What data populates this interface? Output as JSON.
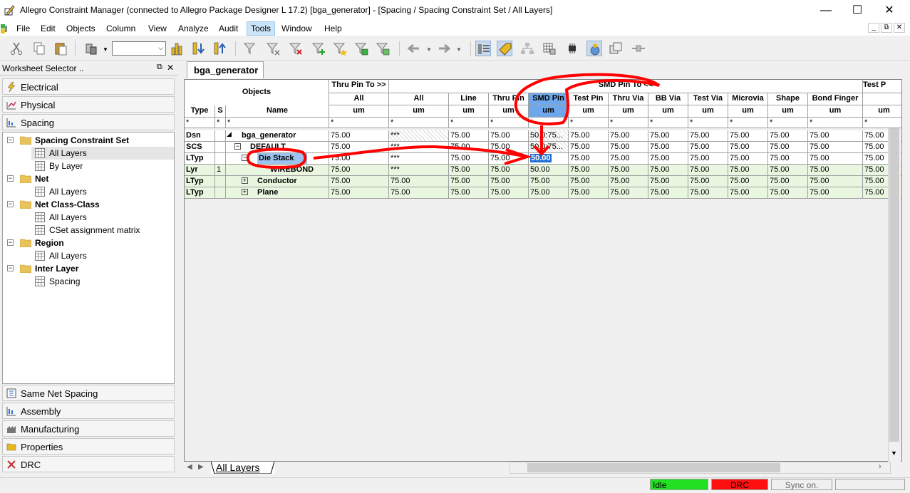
{
  "window": {
    "title": "Allegro Constraint Manager (connected to Allegro Package Designer L 17.2) [bga_generator] - [Spacing / Spacing Constraint Set / All Layers]",
    "minimize_glyph": "—",
    "maximize_glyph": "☐",
    "close_glyph": "✕"
  },
  "menu": [
    "File",
    "Edit",
    "Objects",
    "Column",
    "View",
    "Analyze",
    "Audit",
    "Tools",
    "Window",
    "Help"
  ],
  "active_menu": "Tools",
  "mdi": {
    "min": "_",
    "restore": "⧉",
    "close": "✕"
  },
  "toolbar": {
    "combo_value": ""
  },
  "worksheet_selector": {
    "title": "Worksheet Selector ..",
    "pin_glyph": "⧉",
    "close_glyph": "✕",
    "top_categories": [
      "Electrical",
      "Physical",
      "Spacing"
    ],
    "tree": [
      {
        "label": "Spacing Constraint Set",
        "bold": true,
        "children": [
          "All Layers",
          "By Layer"
        ],
        "selected_child": "All Layers"
      },
      {
        "label": "Net",
        "bold": true,
        "children": [
          "All Layers"
        ]
      },
      {
        "label": "Net Class-Class",
        "bold": true,
        "children": [
          "All Layers",
          "CSet assignment matrix"
        ]
      },
      {
        "label": "Region",
        "bold": true,
        "children": [
          "All Layers"
        ]
      },
      {
        "label": "Inter Layer",
        "bold": true,
        "children": [
          "Spacing"
        ]
      }
    ],
    "bottom_categories": [
      "Same Net Spacing",
      "Assembly",
      "Manufacturing",
      "Properties",
      "DRC"
    ]
  },
  "document_tab": "bga_generator",
  "grid": {
    "objects_header": "Objects",
    "thru_pin_group": "Thru Pin To >>",
    "smd_pin_group": "SMD Pin To <<",
    "test_group": "Test P",
    "col_headers": {
      "type": "Type",
      "s": "S",
      "name": "Name",
      "thru_all": "All",
      "all": "All",
      "line": "Line",
      "thru_pin": "Thru Pin",
      "smd_pin": "SMD Pin",
      "test_pin": "Test Pin",
      "thru_via": "Thru Via",
      "bb_via": "BB Via",
      "test_via": "Test Via",
      "microvia": "Microvia",
      "shape": "Shape",
      "bond_finger": "Bond Finger",
      "last": ""
    },
    "units": "um",
    "filter": "*",
    "rows": [
      {
        "type": "Dsn",
        "s": "",
        "toggle": "◢",
        "name": "bga_generator",
        "vals": [
          "75.00",
          "***",
          "75.00",
          "75.00",
          "50.0:75...",
          "75.00",
          "75.00",
          "75.00",
          "75.00",
          "75.00",
          "75.00",
          "75.00",
          "75.00"
        ]
      },
      {
        "type": "SCS",
        "s": "",
        "toggle": "−",
        "name": "DEFAULT",
        "vals": [
          "75.00",
          "***",
          "75.00",
          "75.00",
          "50.0:75...",
          "75.00",
          "75.00",
          "75.00",
          "75.00",
          "75.00",
          "75.00",
          "75.00",
          "75.00"
        ]
      },
      {
        "type": "LTyp",
        "s": "",
        "toggle": "−",
        "name": "Die Stack",
        "vals": [
          "75.00",
          "***",
          "75.00",
          "75.00",
          "50.00",
          "75.00",
          "75.00",
          "75.00",
          "75.00",
          "75.00",
          "75.00",
          "75.00",
          "75.00"
        ]
      },
      {
        "type": "Lyr",
        "s": "1",
        "toggle": "",
        "name": "WIREBOND",
        "vals": [
          "75.00",
          "***",
          "75.00",
          "75.00",
          "50.00",
          "75.00",
          "75.00",
          "75.00",
          "75.00",
          "75.00",
          "75.00",
          "75.00",
          "75.00"
        ]
      },
      {
        "type": "LTyp",
        "s": "",
        "toggle": "+",
        "name": "Conductor",
        "vals": [
          "75.00",
          "75.00",
          "75.00",
          "75.00",
          "75.00",
          "75.00",
          "75.00",
          "75.00",
          "75.00",
          "75.00",
          "75.00",
          "75.00",
          "75.00"
        ]
      },
      {
        "type": "LTyp",
        "s": "",
        "toggle": "+",
        "name": "Plane",
        "vals": [
          "75.00",
          "75.00",
          "75.00",
          "75.00",
          "75.00",
          "75.00",
          "75.00",
          "75.00",
          "75.00",
          "75.00",
          "75.00",
          "75.00",
          "75.00"
        ]
      }
    ]
  },
  "sheet_tab": "All Layers",
  "status": {
    "idle": "Idle",
    "drc": "DRC",
    "sync": "Sync on."
  },
  "colors": {
    "idle_green": "#22e022",
    "drc_red": "#ff1010",
    "annotation_red": "#ff0000"
  }
}
